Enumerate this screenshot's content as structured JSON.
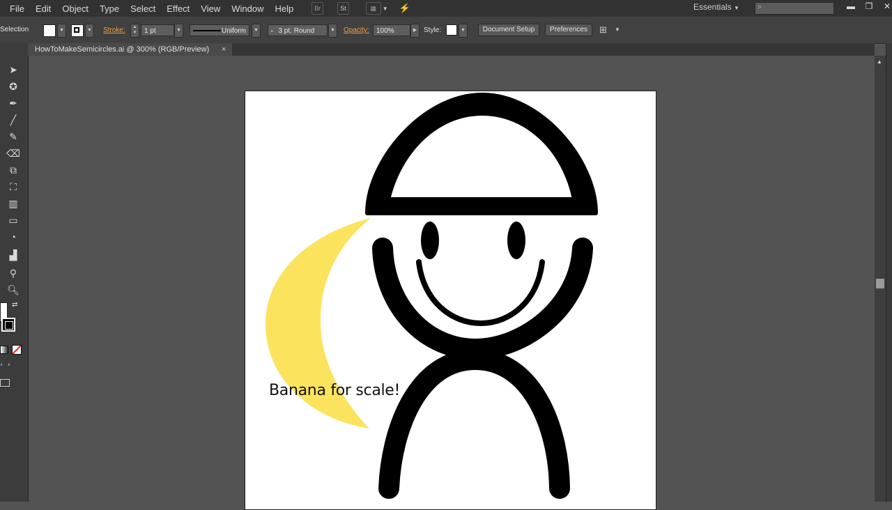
{
  "menu": [
    "File",
    "Edit",
    "Object",
    "Type",
    "Select",
    "Effect",
    "View",
    "Window",
    "Help"
  ],
  "menubar_icons": {
    "bridge": "Br",
    "stock": "St"
  },
  "workspace": "Essentials",
  "controlbar": {
    "selection_label": "Selection",
    "stroke_label": "Stroke:",
    "stroke_weight": "1 pt",
    "profile": "Uniform",
    "brush": "3 pt. Round",
    "opacity_label": "Opacity:",
    "opacity_value": "100%",
    "style_label": "Style:",
    "doc_setup": "Document Setup",
    "preferences": "Preferences"
  },
  "tab": {
    "title": "HowToMakeSemicircles.ai @ 300% (RGB/Preview)",
    "close": "×"
  },
  "artboard": {
    "caption": "Banana for scale!"
  },
  "colors": {
    "banana": "#FCE35E",
    "ink": "#000000",
    "accent_orange": "#F0A03C"
  }
}
